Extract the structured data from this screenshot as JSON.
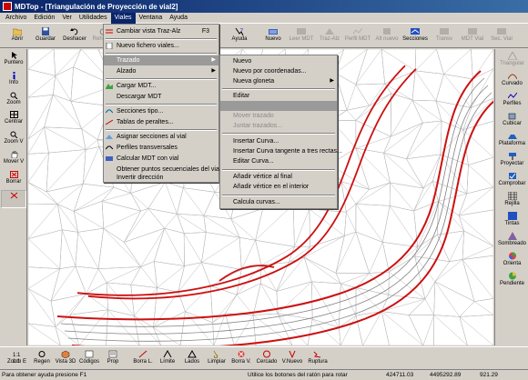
{
  "window": {
    "title": "MDTop - [Triangulación de Proyección de vial2]"
  },
  "menubar": [
    "Archivo",
    "Edición",
    "Ver",
    "Utilidades",
    "Viales",
    "Ventana",
    "Ayuda"
  ],
  "toolbar": [
    {
      "label": "Abrir",
      "icon": "open-folder-icon"
    },
    {
      "label": "Guardar",
      "icon": "save-disk-icon"
    },
    {
      "label": "Deshacer",
      "icon": "undo-icon"
    },
    {
      "label": "Rehacer",
      "icon": "redo-icon"
    },
    {
      "label": "Ayuda",
      "icon": "help-icon"
    },
    {
      "label": "Nuevo",
      "icon": "new-icon"
    },
    {
      "label": "Leer MDT",
      "icon": "read-mdt-icon"
    },
    {
      "label": "Traz-Alz",
      "icon": "traz-alz-icon"
    },
    {
      "label": "Perfil MDT",
      "icon": "perfil-mdt-icon"
    },
    {
      "label": "Alt nuevo",
      "icon": "alt-nuevo-icon"
    },
    {
      "label": "Secciones",
      "icon": "secciones-icon"
    },
    {
      "label": "Transv",
      "icon": "transv-icon"
    },
    {
      "label": "MDT Vial",
      "icon": "mdt-vial-icon"
    },
    {
      "label": "Sec. Vial",
      "icon": "sec-vial-icon"
    }
  ],
  "leftbar": [
    {
      "label": "Puntero",
      "icon": "pointer-icon"
    },
    {
      "label": "Info",
      "icon": "info-icon"
    },
    {
      "label": "Zoom",
      "icon": "zoom-icon"
    },
    {
      "label": "Centrar",
      "icon": "center-icon"
    },
    {
      "label": "Zoom V",
      "icon": "zoom-v-icon"
    },
    {
      "label": "Mover V",
      "icon": "hand-icon"
    },
    {
      "label": "Borrar",
      "icon": "erase-icon"
    },
    {
      "label": "",
      "icon": "pick-icon"
    }
  ],
  "rightbar": [
    {
      "label": "Triangular",
      "icon": "triangular-icon"
    },
    {
      "label": "Curvado",
      "icon": "curvado-icon"
    },
    {
      "label": "Perfiles",
      "icon": "perfiles-icon"
    },
    {
      "label": "Cubicar",
      "icon": "cubicar-icon"
    },
    {
      "label": "Plataforma",
      "icon": "plataforma-icon"
    },
    {
      "label": "Proyectar",
      "icon": "proyectar-icon"
    },
    {
      "label": "Comprobar",
      "icon": "comprobar-icon"
    },
    {
      "label": "Rejilla",
      "icon": "rejilla-icon"
    },
    {
      "label": "Tintas",
      "icon": "tintas-icon"
    },
    {
      "label": "Sombreado",
      "icon": "sombreado-icon"
    },
    {
      "label": "Orienta",
      "icon": "orienta-icon"
    },
    {
      "label": "Pendiente",
      "icon": "pendiente-icon"
    }
  ],
  "bottombar": [
    {
      "label": "1:1",
      "icon": "scale-icon"
    },
    {
      "label": "Zoom E",
      "icon": "zoom-e-icon"
    },
    {
      "label": "Regen",
      "icon": "regen-icon"
    },
    {
      "label": "Vista 3D",
      "icon": "view-3d-icon"
    },
    {
      "label": "Códigos",
      "icon": "codes-icon"
    },
    {
      "label": "Prop",
      "icon": "properties-icon"
    },
    {
      "label": "Borra L.",
      "icon": "erase-l-icon"
    },
    {
      "label": "Límite",
      "icon": "limit-icon"
    },
    {
      "label": "Lados",
      "icon": "sides-icon"
    },
    {
      "label": "Limpiar",
      "icon": "clean-icon"
    },
    {
      "label": "Borra V.",
      "icon": "erase-v-icon"
    },
    {
      "label": "Cercado",
      "icon": "fence-icon"
    },
    {
      "label": "V.Nuevo",
      "icon": "v-new-icon"
    },
    {
      "label": "Ruptura",
      "icon": "break-icon"
    }
  ],
  "status": {
    "hint": "Para obtener ayuda presione F1",
    "mouse_hint": "Utilice los botones del ratón para rotar",
    "x": "424711.03",
    "y": "4495292.89",
    "z": "921.29"
  },
  "viales_menu": {
    "items": [
      {
        "label": "Cambiar vista Traz-Alz",
        "shortcut": "F3",
        "icon": "swap-icon"
      },
      {
        "label": "Nuevo fichero viales...",
        "icon": "new-file-icon"
      },
      {
        "label": "Trazado",
        "submenu": true,
        "highlighted": true
      },
      {
        "label": "Alzado",
        "submenu": true
      },
      {
        "label": "Cargar MDT...",
        "icon": "load-mdt-icon"
      },
      {
        "label": "Descargar MDT"
      },
      {
        "label": "Secciones tipo...",
        "icon": "section-type-icon"
      },
      {
        "label": "Tablas de peraltes...",
        "icon": "cant-table-icon"
      },
      {
        "label": "Asignar secciones al vial",
        "icon": "assign-icon"
      },
      {
        "label": "Perfiles transversales",
        "icon": "cross-profile-icon"
      },
      {
        "label": "Calcular MDT con vial",
        "icon": "calc-mdt-icon"
      },
      {
        "label": "Obtener puntos secuenciales del vial..."
      },
      {
        "label": "Invertir dirección"
      }
    ]
  },
  "trazado_menu": {
    "items": [
      {
        "label": "Nuevo"
      },
      {
        "label": "Nuevo por coordenadas..."
      },
      {
        "label": "Nueva gloneta",
        "submenu": true
      },
      {
        "label": "Editar"
      },
      {
        "label": "",
        "highlighted": true
      },
      {
        "label": "Mover trazado",
        "disabled": true
      },
      {
        "label": "Juntar trazados...",
        "disabled": true
      },
      {
        "label": "Insertar Curva..."
      },
      {
        "label": "Insertar Curva tangente a tres rectas..."
      },
      {
        "label": "Editar Curva..."
      },
      {
        "label": "Añadir vértice al final"
      },
      {
        "label": "Añadir vértice en el interior"
      },
      {
        "label": "Calcula curvas..."
      }
    ]
  }
}
